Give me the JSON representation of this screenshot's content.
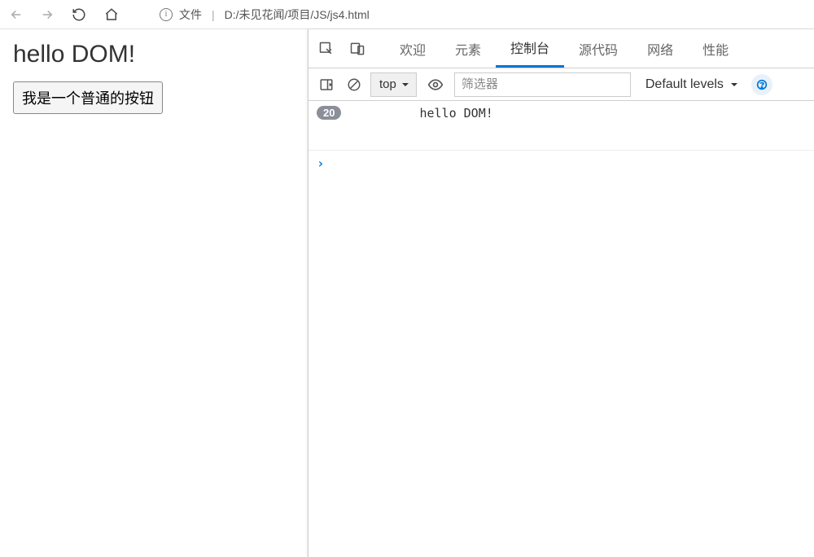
{
  "browser": {
    "file_label": "文件",
    "divider": "|",
    "url": "D:/未见花闻/项目/JS/js4.html"
  },
  "page": {
    "heading": "hello DOM!",
    "button_label": "我是一个普通的按钮"
  },
  "devtools": {
    "tabs": {
      "welcome": "欢迎",
      "elements": "元素",
      "console": "控制台",
      "sources": "源代码",
      "network": "网络",
      "performance": "性能"
    },
    "toolbar": {
      "context": "top",
      "filter_placeholder": "筛选器",
      "levels": "Default levels"
    },
    "console": {
      "count": "20",
      "message": "hello DOM!"
    }
  }
}
